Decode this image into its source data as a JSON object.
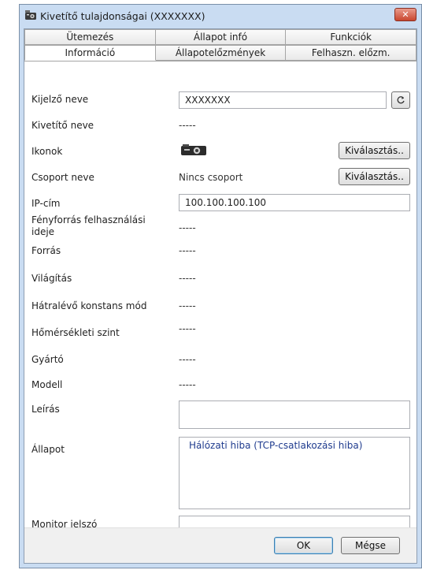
{
  "window": {
    "title": "Kivetítő tulajdonságai (XXXXXXX)",
    "close": "✕"
  },
  "tabs": {
    "back": [
      "Ütemezés",
      "Állapot infó",
      "Funkciók"
    ],
    "front": [
      "Információ",
      "Állapotelőzmények",
      "Felhaszn. előzm."
    ]
  },
  "fields": {
    "display_name": {
      "label": "Kijelző neve",
      "value": "XXXXXXX"
    },
    "projector_name": {
      "label": "Kivetítő neve",
      "value": "-----"
    },
    "icons": {
      "label": "Ikonok",
      "button": "Kiválasztás.."
    },
    "group_name": {
      "label": "Csoport neve",
      "value": "Nincs csoport",
      "button": "Kiválasztás.."
    },
    "ip": {
      "label": "IP-cím",
      "value": "100.100.100.100"
    },
    "lamp_hours": {
      "label": "Fényforrás felhasználási ideje",
      "value": "-----"
    },
    "source": {
      "label": "Forrás",
      "value": "-----"
    },
    "lighting": {
      "label": "Világítás",
      "value": "-----"
    },
    "constant_mode": {
      "label": "Hátralévő konstans mód",
      "value": "-----"
    },
    "temperature": {
      "label": "Hőmérsékleti szint",
      "value": "-----"
    },
    "manufacturer": {
      "label": "Gyártó",
      "value": "-----"
    },
    "model": {
      "label": "Modell",
      "value": "-----"
    },
    "description": {
      "label": "Leírás",
      "value": ""
    },
    "status": {
      "label": "Állapot",
      "value": "Hálózati hiba (TCP-csatlakozási hiba)"
    },
    "monitor_password": {
      "label": "Monitor jelszó",
      "value": ""
    }
  },
  "footer": {
    "ok": "OK",
    "cancel": "Mégse"
  }
}
